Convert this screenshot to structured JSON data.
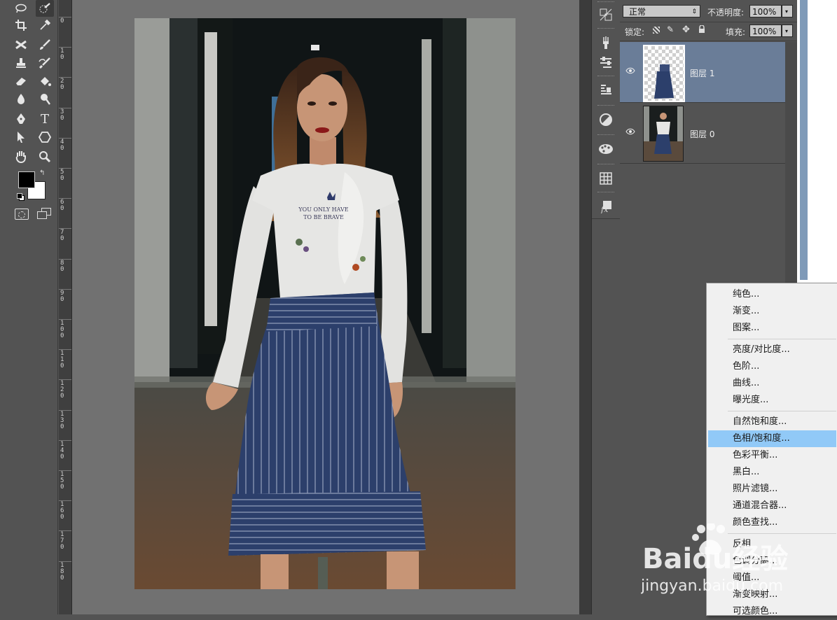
{
  "layers_panel": {
    "blend_mode": "正常",
    "opacity_label": "不透明度:",
    "opacity_value": "100%",
    "lock_label": "锁定:",
    "fill_label": "填充:",
    "fill_value": "100%",
    "layers": [
      {
        "name": "图层 1",
        "selected": true
      },
      {
        "name": "图层 0",
        "selected": false
      }
    ]
  },
  "ruler_ticks": [
    "0",
    "1 0",
    "2 0",
    "3 0",
    "4 0",
    "5 0",
    "6 0",
    "7 0",
    "8 0",
    "9 0",
    "1 0 0",
    "1 1 0",
    "1 2 0",
    "1 3 0",
    "1 4 0",
    "1 5 0",
    "1 6 0",
    "1 7 0",
    "1 8 0"
  ],
  "adjustment_menu": {
    "groups": [
      [
        "纯色...",
        "渐变...",
        "图案..."
      ],
      [
        "亮度/对比度...",
        "色阶...",
        "曲线...",
        "曝光度..."
      ],
      [
        "自然饱和度...",
        "色相/饱和度...",
        "色彩平衡...",
        "黑白...",
        "照片滤镜...",
        "通道混合器...",
        "颜色查找..."
      ],
      [
        "反相",
        "色调分离...",
        "阈值...",
        "渐变映射...",
        "可选颜色..."
      ]
    ],
    "highlighted": "色相/饱和度..."
  },
  "photo": {
    "shirt_text_1": "YOU ONLY HAVE",
    "shirt_text_2": "TO BE BRAVE"
  },
  "watermark": {
    "brand": "Baidu经验",
    "url": "jingyan.baidu.com"
  },
  "colors": {
    "panel": "#535353",
    "canvas_bg": "#717171",
    "layer_selected": "#6a7d98",
    "menu_highlight": "#91c9f7",
    "skirt": "#2c3f6b",
    "shirt": "#e6e6e4"
  },
  "tool_icons": [
    "lasso-icon",
    "quick-selection-icon",
    "crop-icon",
    "eyedropper-icon",
    "healing-icon",
    "brush-icon",
    "stamp-icon",
    "history-brush-icon",
    "eraser-icon",
    "paint-bucket-icon",
    "blur-icon",
    "dodge-icon",
    "pen-icon",
    "type-icon",
    "path-selection-icon",
    "shape-icon",
    "hand-icon",
    "zoom-icon"
  ],
  "panel_icons": [
    "swatches-icon",
    "brush-preset-icon",
    "adjustments-icon",
    "character-icon",
    "color-icon",
    "palette-icon",
    "grid-icon",
    "styles-icon"
  ]
}
